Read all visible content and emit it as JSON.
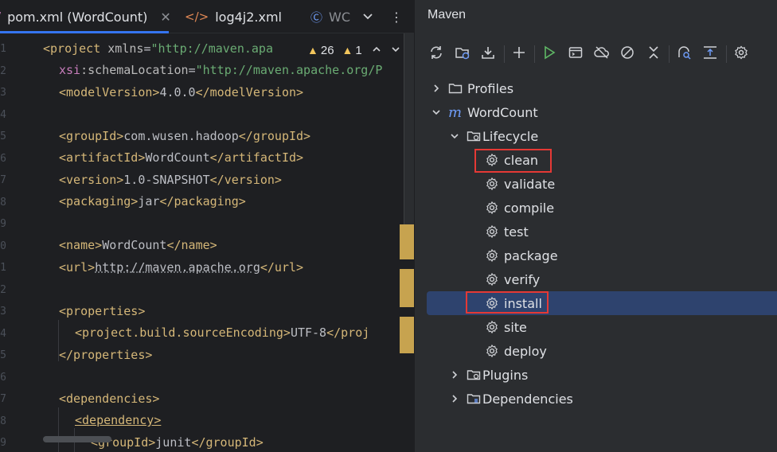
{
  "editor": {
    "tabs": [
      {
        "label": "pom.xml (WordCount)",
        "icon": "maven-file-icon",
        "active": true
      },
      {
        "label": "log4j2.xml",
        "icon": "xml-file-icon",
        "active": false
      },
      {
        "label": "WC",
        "icon": "class-file-icon",
        "active": false
      }
    ],
    "inspection": {
      "warnings": "26",
      "errors": "1"
    },
    "line_numbers": [
      "1",
      "2",
      "3",
      "4",
      "5",
      "6",
      "7",
      "8",
      "9",
      "0",
      "1",
      "2",
      "3",
      "4",
      "5",
      "6",
      "7",
      "8",
      "9"
    ],
    "code": {
      "l1_tag": "<project",
      "l1_attr": " xmlns",
      "l1_eq": "=",
      "l1_val": "\"http://maven.apa",
      "l2_ns": "xsi",
      "l2_attr": ":schemaLocation",
      "l2_eq": "=",
      "l2_val": "\"http://maven.apache.org/P",
      "l3_open": "<modelVersion>",
      "l3_text": "4.0.0",
      "l3_close": "</modelVersion>",
      "l5_open": "<groupId>",
      "l5_text": "com.wusen.hadoop",
      "l5_close": "</groupId>",
      "l6_open": "<artifactId>",
      "l6_text": "WordCount",
      "l6_close": "</artifactId>",
      "l7_open": "<version>",
      "l7_text": "1.0-SNAPSHOT",
      "l7_close": "</version>",
      "l8_open": "<packaging>",
      "l8_text": "jar",
      "l8_close": "</packaging>",
      "l10_open": "<name>",
      "l10_text": "WordCount",
      "l10_close": "</name>",
      "l11_open": "<url>",
      "l11_link1": "http://",
      "l11_link2": "maven.apache.org",
      "l11_close": "</url>",
      "l13_open": "<properties>",
      "l14_open": "<project.build.sourceEncoding>",
      "l14_text": "UTF-8",
      "l14_close": "</proj",
      "l15_close": "</properties>",
      "l17_open": "<dependencies>",
      "l18_open": "<dependency>",
      "l19_open": "<groupId>",
      "l19_text": "junit",
      "l19_close": "</groupId>"
    }
  },
  "maven": {
    "title": "Maven",
    "toolbar": [
      "reload-icon",
      "reload-folder-icon",
      "download-icon",
      "add-icon",
      "run-icon",
      "execute-goal-icon",
      "offline-icon",
      "skip-tests-icon",
      "collapse-icon",
      "analyze-icon",
      "show-dependencies-icon",
      "settings-icon"
    ],
    "tree": {
      "profiles": "Profiles",
      "project": "WordCount",
      "lifecycle": "Lifecycle",
      "goals": [
        "clean",
        "validate",
        "compile",
        "test",
        "package",
        "verify",
        "install",
        "site",
        "deploy"
      ],
      "plugins": "Plugins",
      "dependencies": "Dependencies"
    },
    "selected_goal": "install",
    "highlighted_goals": [
      "clean",
      "install"
    ],
    "colors": {
      "selection": "#2e436e",
      "highlight_box": "#e53935",
      "accent": "#3574f0"
    }
  }
}
